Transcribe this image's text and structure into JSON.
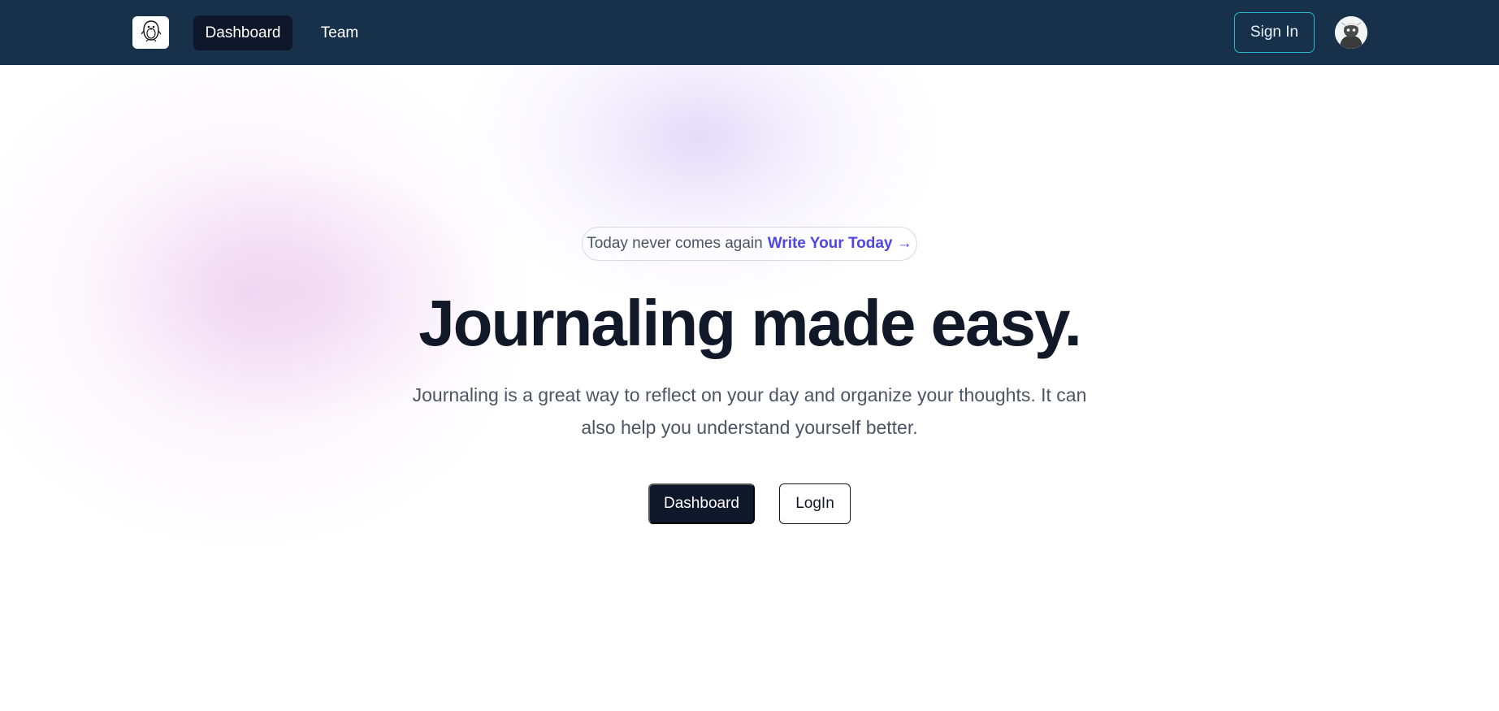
{
  "nav": {
    "logo_icon": "penguin-mascot-icon",
    "links": [
      {
        "label": "Dashboard",
        "active": true
      },
      {
        "label": "Team",
        "active": false
      }
    ],
    "signin_label": "Sign In",
    "avatar_icon": "user-avatar-icon"
  },
  "hero": {
    "pill_text": "Today never comes again",
    "pill_link": "Write Your Today →",
    "headline": "Journaling made easy.",
    "subtext": "Journaling is a great way to reflect on your day and organize your thoughts. It can also help you understand yourself better.",
    "primary_button": "Dashboard",
    "secondary_button": "LogIn"
  },
  "colors": {
    "navbar_bg": "#17314b",
    "active_nav_bg": "#0f172a",
    "signin_border": "#22b8cf",
    "accent_link": "#4f46e5",
    "headline": "#111827",
    "body_text": "#4b5563"
  }
}
